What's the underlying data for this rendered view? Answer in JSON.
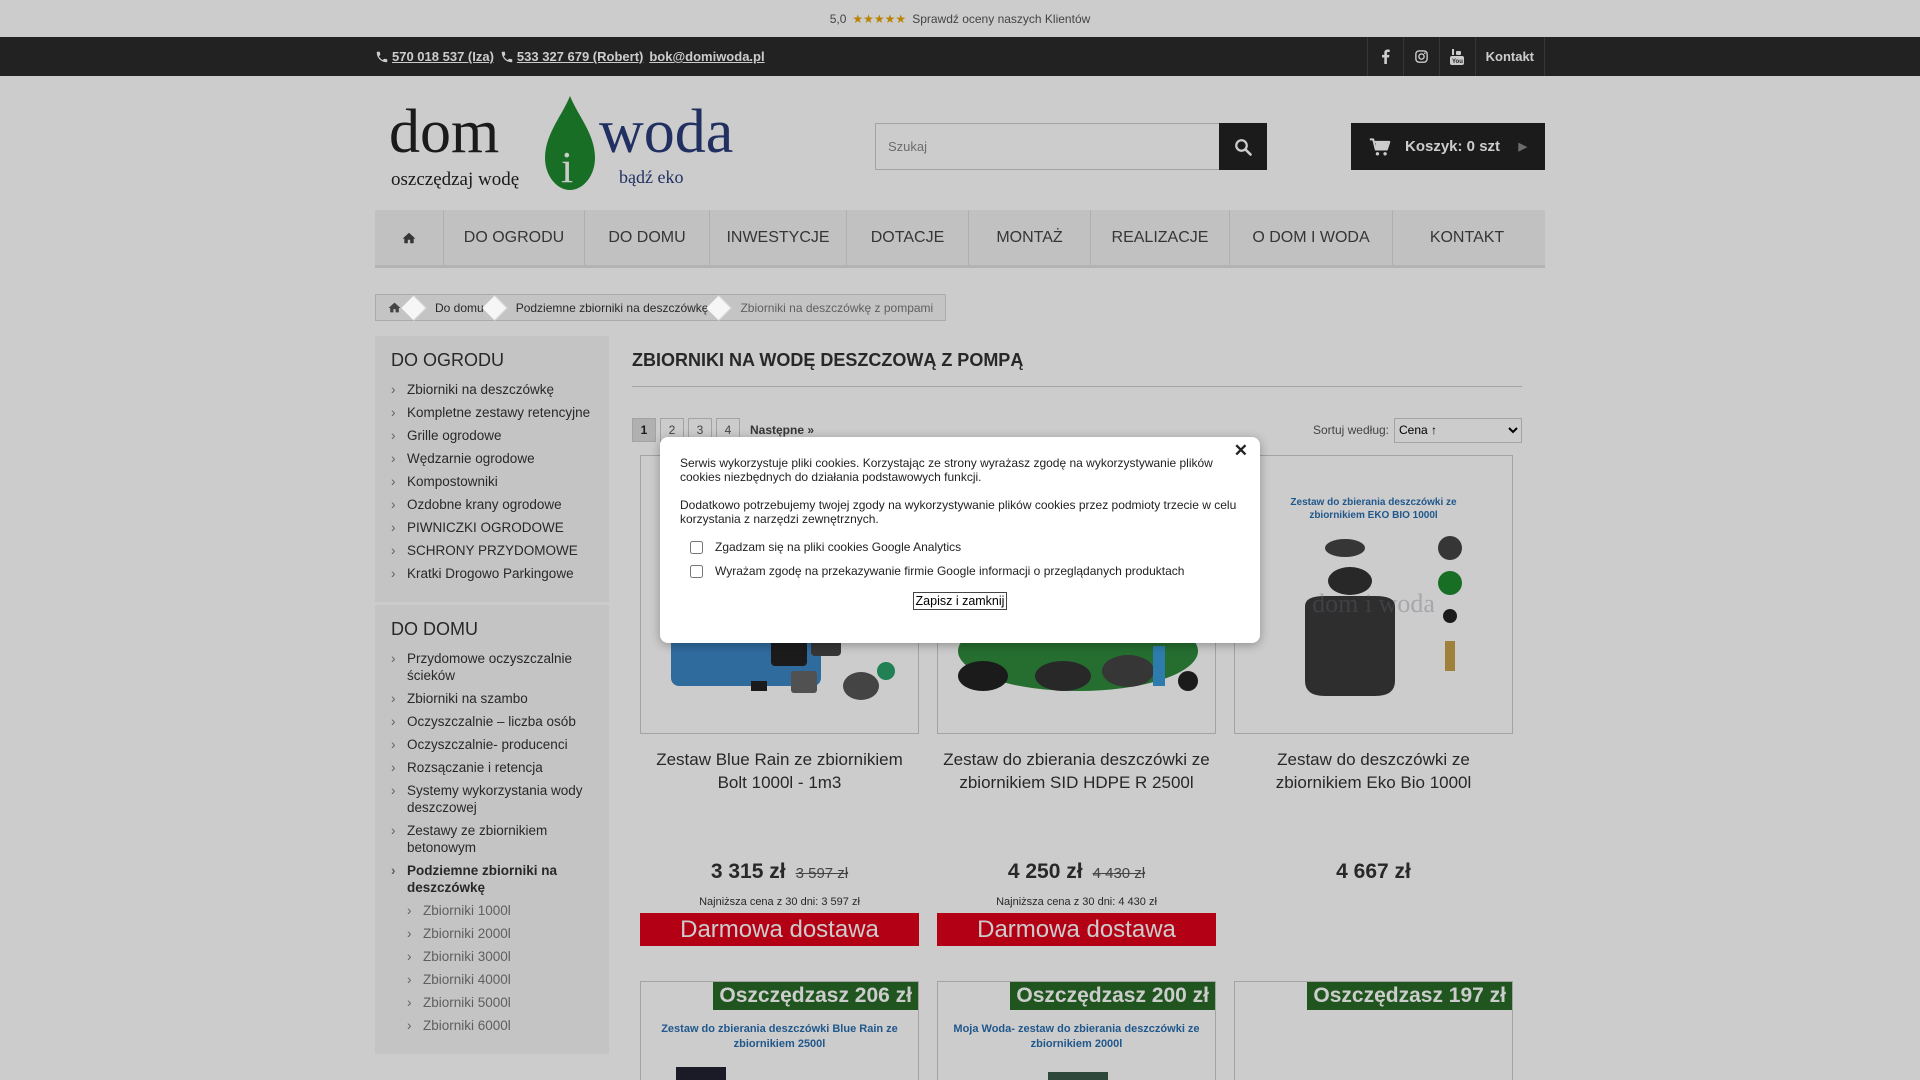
{
  "rating": {
    "score": "5,0",
    "stars": "★★★★★",
    "text": "Sprawdź oceny naszych Klientów"
  },
  "topbar": {
    "phone1": "570 018 537 (Iza)",
    "phone2": "533 327 679 (Robert)",
    "email": "bok@domiwoda.pl",
    "contact_label": "Kontakt"
  },
  "logo": {
    "dom": "dom",
    "i": "i",
    "woda": "woda",
    "tagline_left": "oszczędzaj wodę",
    "tagline_right": "bądź eko"
  },
  "search": {
    "placeholder": "Szukaj"
  },
  "cart": {
    "label": "Koszyk: 0 szt"
  },
  "nav": [
    "DO OGRODU",
    "DO DOMU",
    "INWESTYCJE",
    "DOTACJE",
    "MONTAŻ",
    "REALIZACJE",
    "O DOM I WODA",
    "KONTAKT"
  ],
  "breadcrumb": [
    "Do domu",
    "Podziemne zbiorniki na deszczówkę",
    "Zbiorniki na deszczówkę z pompami"
  ],
  "sidebar": {
    "ogrod_title": "DO OGRODU",
    "ogrod_items": [
      "Zbiorniki na deszczówkę",
      "Kompletne zestawy retencyjne",
      "Grille ogrodowe",
      "Wędzarnie ogrodowe",
      "Kompostowniki",
      "Ozdobne krany ogrodowe",
      "PIWNICZKI OGRODOWE",
      "SCHRONY PRZYDOMOWE",
      "Kratki Drogowo Parkingowe"
    ],
    "dom_title": "DO DOMU",
    "dom_items": [
      "Przydomowe oczyszczalnie ścieków",
      "Zbiorniki na szambo",
      "Oczyszczalnie – liczba osób",
      "Oczyszczalnie- producenci",
      "Rozsączanie i retencja",
      "Systemy wykorzystania wody deszczowej",
      "Zestawy ze zbiornikiem betonowym"
    ],
    "dom_active": "Podziemne zbiorniki na deszczówkę",
    "dom_sub": [
      "Zbiorniki 1000l",
      "Zbiorniki 2000l",
      "Zbiorniki 3000l",
      "Zbiorniki 4000l",
      "Zbiorniki 5000l",
      "Zbiorniki 6000l"
    ]
  },
  "page": {
    "title": "ZBIORNIKI NA WODĘ DESZCZOWĄ Z POMPĄ",
    "pages": [
      "1",
      "2",
      "3",
      "4"
    ],
    "next": "Następne »",
    "sort_label": "Sortuj według:",
    "sort_value": "Cena ↑"
  },
  "products": [
    {
      "name": "Zestaw Blue Rain ze zbiornikiem Bolt 1000l - 1m3",
      "price": "3 315 zł",
      "old": "3 597 zł",
      "lowest": "Najniższa cena z 30 dni: 3 597 zł",
      "badge": "Darmowa dostawa"
    },
    {
      "name": "Zestaw do zbierania deszczówki ze zbiornikiem SID HDPE R 2500l",
      "price": "4 250 zł",
      "old": "4 430 zł",
      "lowest": "Najniższa cena z 30 dni: 4 430 zł",
      "badge": "Darmowa dostawa"
    },
    {
      "name": "Zestaw do deszczówki ze zbiornikiem Eko Bio 1000l",
      "price": "4 667 zł",
      "img_title": "Zestaw do zbierania deszczówki ze zbiornikiem EKO BIO  1000l",
      "watermark": "dom i woda"
    }
  ],
  "products2": [
    {
      "save": "Oszczędzasz 206 zł",
      "img_title": "Zestaw  do zbierania deszczówki Blue Rain ze zbiornikiem 2500l"
    },
    {
      "save": "Oszczędzasz 200 zł",
      "img_title": "Moja Woda- zestaw do zbierania deszczówki ze zbiornikiem 2000l"
    },
    {
      "save": "Oszczędzasz 197 zł",
      "img_title": ""
    }
  ],
  "cookie": {
    "text1": "Serwis wykorzystuje pliki cookies. Korzystając ze strony wyrażasz zgodę na wykorzystywanie plików cookies niezbędnych do działania podstawowych funkcji.",
    "text2": "Dodatkowo potrzebujemy twojej zgody na wykorzystywanie plików cookies przez podmioty trzecie w celu korzystania z narzędzi zewnętrznych.",
    "opt1": "Zgadzam się na pliki cookies Google Analytics",
    "opt2": "Wyrażam zgodę na przekazywanie firmie Google informacji o przeglądanych produktach",
    "save": "Zapisz i zamknij",
    "close": "✕"
  },
  "colors": {
    "accent_red": "#e0001b",
    "save_green": "#2a6b28",
    "dark": "#222222",
    "logo_green": "#1e8a2e",
    "logo_blue": "#2a3d7a"
  }
}
